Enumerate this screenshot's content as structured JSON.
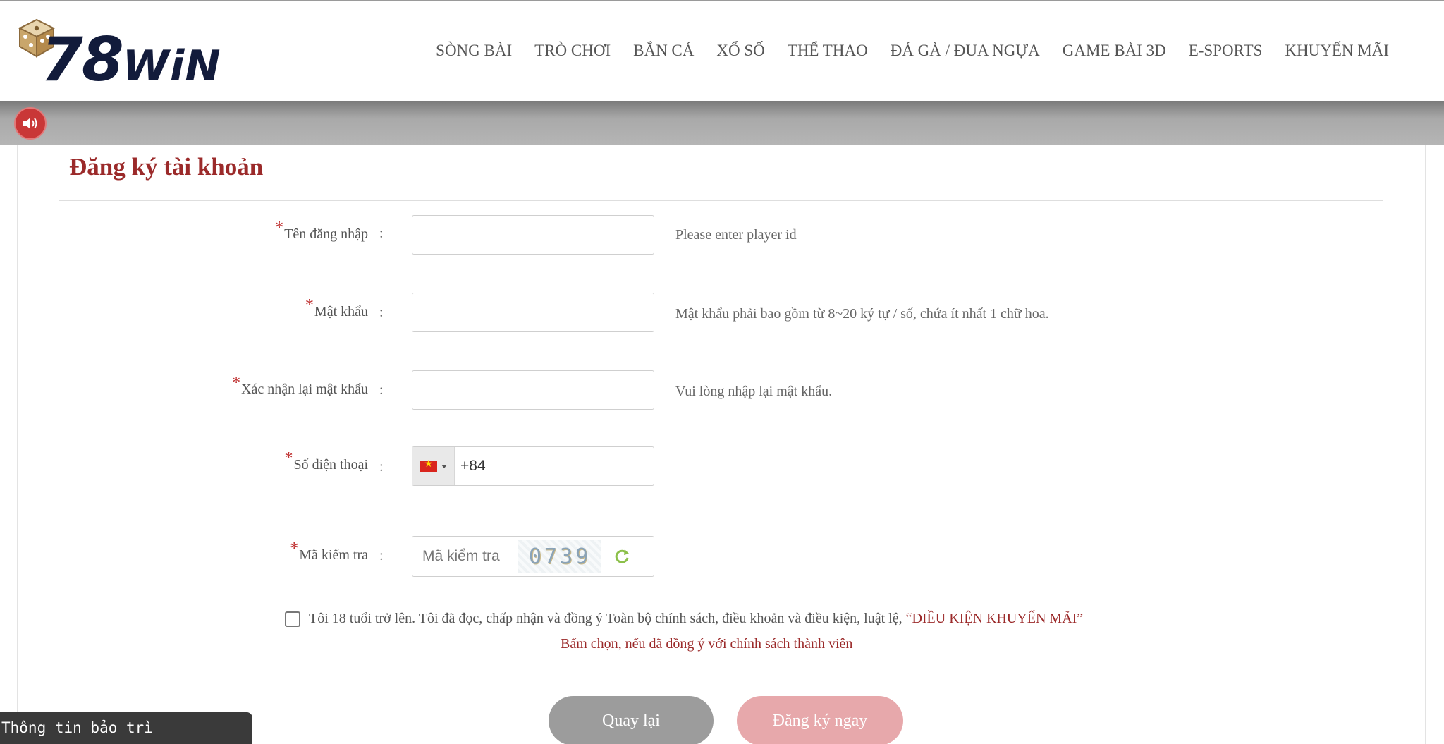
{
  "header": {
    "logo_text_big": "78",
    "logo_text_small": "WiN",
    "nav": [
      {
        "label": "SÒNG BÀI"
      },
      {
        "label": "TRÒ CHƠI"
      },
      {
        "label": "BẮN CÁ"
      },
      {
        "label": "XỔ SỐ"
      },
      {
        "label": "THỂ THAO"
      },
      {
        "label": "ĐÁ GÀ / ĐUA NGỰA"
      },
      {
        "label": "GAME BÀI 3D"
      },
      {
        "label": "E-SPORTS"
      },
      {
        "label": "KHUYẾN MÃI"
      }
    ]
  },
  "form": {
    "title": "Đăng ký tài khoản",
    "required_mark": "*",
    "colon": ":",
    "username": {
      "label": "Tên đăng nhập",
      "value": "",
      "hint": "Please enter player id"
    },
    "password": {
      "label": "Mật khẩu",
      "value": "",
      "hint": "Mật khẩu phải bao gồm từ 8~20 ký tự / số, chứa ít nhất 1 chữ hoa."
    },
    "confirm_password": {
      "label": "Xác nhận lại mật khẩu",
      "value": "",
      "hint": "Vui lòng nhập lại mật khẩu."
    },
    "phone": {
      "label": "Số điện thoại",
      "value": "+84",
      "country": "VN"
    },
    "captcha": {
      "label": "Mã kiểm tra",
      "placeholder": "Mã kiểm tra",
      "code": "0739"
    },
    "agreement": {
      "text": "Tôi 18 tuổi trở lên. Tôi đã đọc, chấp nhận và đồng ý Toàn bộ chính sách, điều khoản và điều kiện, luật lệ,",
      "link": "“ĐIỀU KIỆN KHUYẾN MÃI”",
      "note": "Bấm chọn, nếu đã đồng ý với chính sách thành viên",
      "checked": false
    },
    "back_button": "Quay lại",
    "register_button": "Đăng ký ngay"
  },
  "maintenance": {
    "label": "Thông tin bảo trì"
  },
  "colors": {
    "accent": "#9b2a2a",
    "register_button": "#e7a8ab",
    "back_button": "#9c9c9c",
    "sound_button": "#c93737"
  }
}
